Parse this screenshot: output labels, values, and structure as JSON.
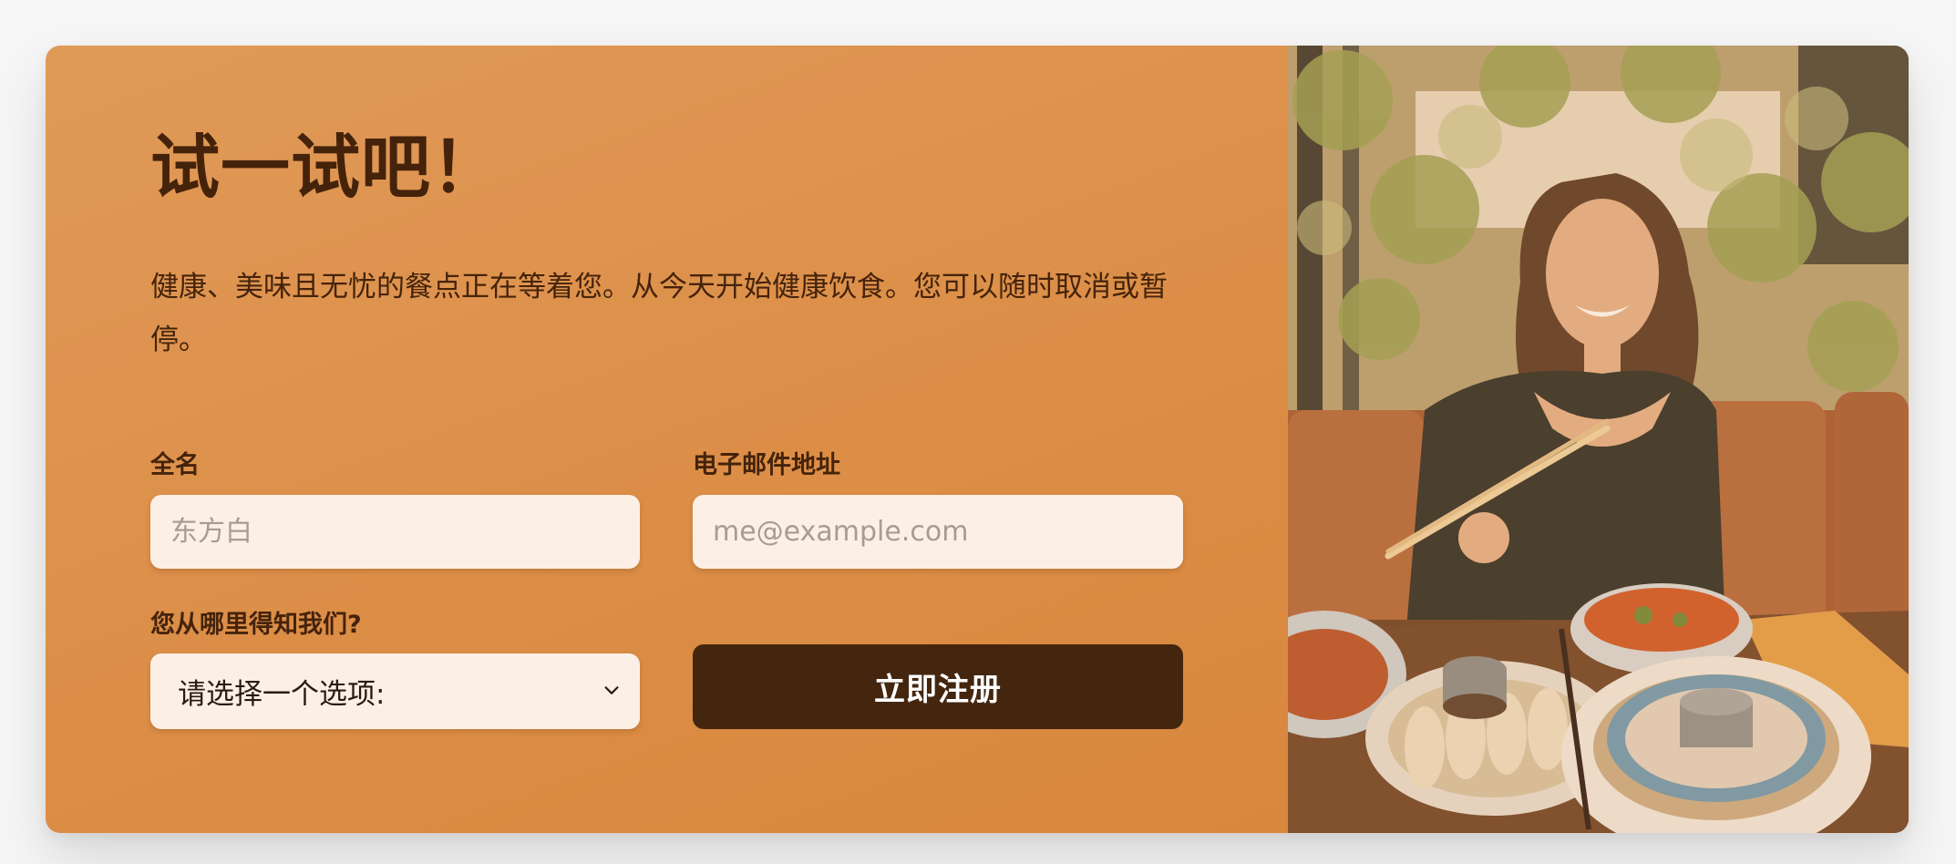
{
  "form": {
    "title": "试一试吧！",
    "description": "健康、美味且无忧的餐点正在等着您。从今天开始健康饮食。您可以随时取消或暂停。",
    "name_label": "全名",
    "name_placeholder": "东方白",
    "email_label": "电子邮件地址",
    "email_placeholder": "me@example.com",
    "source_label": "您从哪里得知我们?",
    "source_selected": "请选择一个选项:",
    "submit_label": "立即注册"
  },
  "colors": {
    "panel_bg": "#dc8e47",
    "text_dark": "#45230b",
    "input_bg": "#fcf0e6",
    "button_bg": "#44260f"
  },
  "icons": {
    "select": "chevron-down-icon"
  }
}
